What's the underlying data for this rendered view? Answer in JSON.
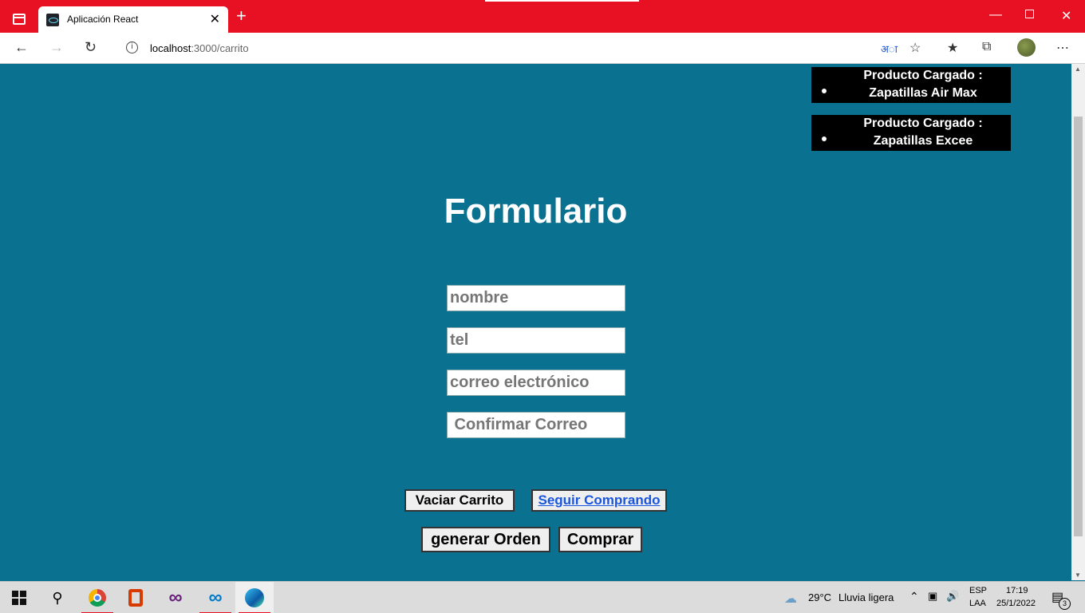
{
  "browser": {
    "tab_title": "Aplicación React",
    "url_host": "localhost",
    "url_path": ":3000/carrito",
    "new_tab_label": "+",
    "close_tab_label": "✕"
  },
  "products": [
    {
      "label": "Producto Cargado :",
      "name": "Zapatillas Air Max"
    },
    {
      "label": "Producto Cargado :",
      "name": "Zapatillas Excee"
    }
  ],
  "form": {
    "title": "Formulario",
    "fields": [
      {
        "placeholder": "nombre"
      },
      {
        "placeholder": "tel"
      },
      {
        "placeholder": "correo electrónico"
      },
      {
        "placeholder": " Confirmar Correo"
      }
    ]
  },
  "buttons": {
    "vaciar": "Vaciar Carrito",
    "seguir": "Seguir Comprando",
    "generar": "generar Orden",
    "comprar": "Comprar"
  },
  "taskbar": {
    "temperature": "29°C",
    "weather": "Lluvia ligera",
    "lang_top": "ESP",
    "lang_bottom": "LAA",
    "time": "17:19",
    "date": "25/1/2022",
    "notifications": "3"
  },
  "colors": {
    "titlebar": "#e81123",
    "page_bg": "#0b7190",
    "product_bg": "#000000"
  }
}
